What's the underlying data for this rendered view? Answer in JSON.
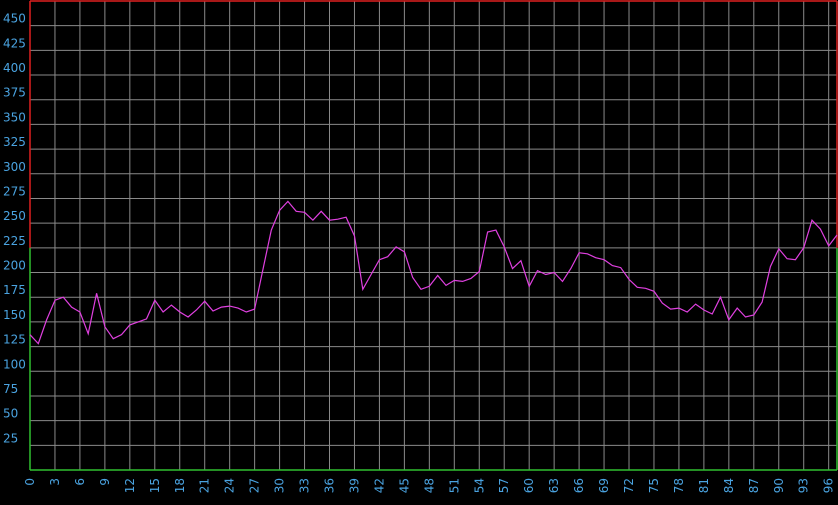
{
  "chart_data": {
    "type": "line",
    "title": "",
    "xlabel": "",
    "ylabel": "",
    "xlim": [
      0,
      97
    ],
    "ylim": [
      0,
      475
    ],
    "grid": true,
    "x_tick_labels": [
      "0",
      "3",
      "6",
      "9",
      "12",
      "15",
      "18",
      "21",
      "24",
      "27",
      "30",
      "33",
      "36",
      "39",
      "42",
      "45",
      "48",
      "51",
      "54",
      "57",
      "60",
      "63",
      "66",
      "69",
      "72",
      "75",
      "78",
      "81",
      "84",
      "87",
      "90",
      "93",
      "96"
    ],
    "y_tick_labels": [
      "25",
      "50",
      "75",
      "100",
      "125",
      "150",
      "175",
      "200",
      "225",
      "250",
      "275",
      "300",
      "325",
      "350",
      "375",
      "400",
      "425",
      "450"
    ],
    "colors": {
      "background": "#000000",
      "series": "#e040e0",
      "grid": "#8a8a8a",
      "ticks": "#4aa3e0",
      "zone_upper": "#e02020",
      "zone_lower": "#30c030"
    },
    "zones": {
      "upper_from": 225,
      "lower_to": 225
    },
    "series": [
      {
        "values": [
          137,
          128,
          152,
          172,
          175,
          165,
          160,
          138,
          179,
          145,
          133,
          137,
          147,
          150,
          153,
          172,
          160,
          167,
          160,
          155,
          162,
          171,
          161,
          165,
          166,
          164,
          160,
          163,
          203,
          243,
          263,
          272,
          262,
          261,
          253,
          262,
          253,
          254,
          256,
          237,
          183,
          198,
          213,
          216,
          226,
          221,
          195,
          183,
          186,
          197,
          187,
          192,
          191,
          194,
          201,
          241,
          243,
          226,
          204,
          212,
          186,
          202,
          198,
          200,
          191,
          204,
          220,
          219,
          215,
          213,
          207,
          205,
          193,
          185,
          184,
          181,
          169,
          163,
          164,
          160,
          168,
          162,
          158,
          175,
          152,
          164,
          155,
          157,
          170,
          206,
          224,
          214,
          213,
          225,
          253,
          244,
          227,
          238
        ]
      }
    ]
  }
}
